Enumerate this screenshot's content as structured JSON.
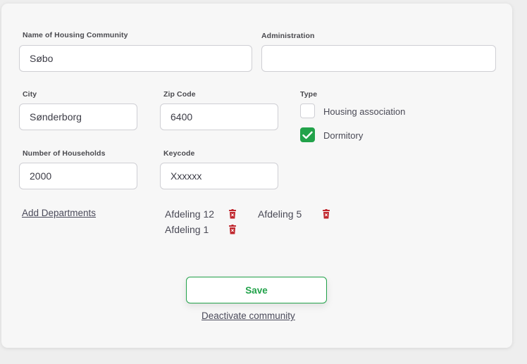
{
  "form": {
    "community_name": {
      "label": "Name of Housing Community",
      "value": "Søbo"
    },
    "administration": {
      "label": "Administration",
      "value": ""
    },
    "city": {
      "label": "City",
      "value": "Sønderborg"
    },
    "zip_code": {
      "label": "Zip Code",
      "value": "6400"
    },
    "households": {
      "label": "Number of Households",
      "value": "2000"
    },
    "keycode": {
      "label": "Keycode",
      "value": "Xxxxxx"
    },
    "type": {
      "label": "Type",
      "options": [
        {
          "label": "Housing association",
          "checked": false
        },
        {
          "label": "Dormitory",
          "checked": true
        }
      ]
    }
  },
  "departments": {
    "add_label": "Add Departments",
    "items": [
      {
        "name": "Afdeling 12"
      },
      {
        "name": "Afdeling 5"
      },
      {
        "name": "Afdeling 1"
      }
    ]
  },
  "actions": {
    "save_label": "Save",
    "deactivate_label": "Deactivate community"
  },
  "colors": {
    "accent_green": "#22a24a",
    "delete_red": "#c0262d"
  },
  "icons": {
    "checkbox_check": "check-icon",
    "department_delete": "trash-icon"
  }
}
